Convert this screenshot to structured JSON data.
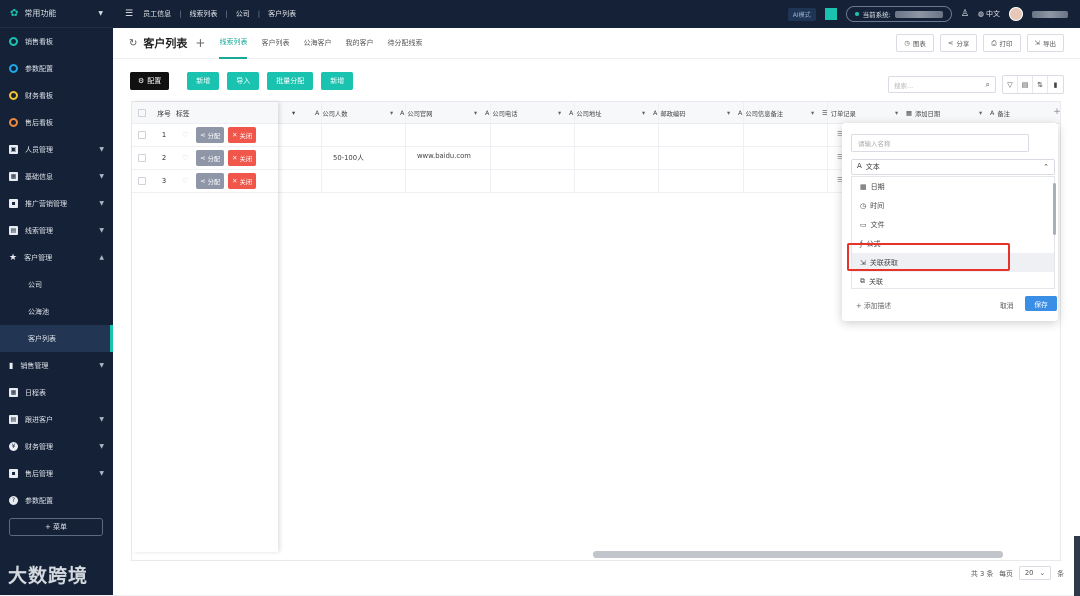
{
  "sidebar": {
    "top_label": "常用功能",
    "items": [
      {
        "label": "销售看板",
        "ring": "#19c3b0"
      },
      {
        "label": "参数配置",
        "ring": "#1ea8e8"
      },
      {
        "label": "财务看板",
        "ring": "#f2c230"
      },
      {
        "label": "售后看板",
        "ring": "#f08a3c"
      },
      {
        "label": "人员管理"
      },
      {
        "label": "基础信息"
      },
      {
        "label": "推广营销管理"
      },
      {
        "label": "线索管理"
      },
      {
        "label": "客户管理"
      },
      {
        "label": "公司"
      },
      {
        "label": "公海池"
      },
      {
        "label": "客户列表"
      },
      {
        "label": "销售管理"
      },
      {
        "label": "日程表"
      },
      {
        "label": "跟进客户"
      },
      {
        "label": "财务管理"
      },
      {
        "label": "售后管理"
      },
      {
        "label": "参数配置"
      }
    ],
    "menu_button": "+ 菜单",
    "watermark": "大数跨境"
  },
  "topbar": {
    "breadcrumb": [
      "员工信息",
      "线索列表",
      "公司",
      "客户列表"
    ],
    "ai_label": "AI模式",
    "system_label": "当前系统:",
    "lang": "中文"
  },
  "page": {
    "title": "客户列表",
    "tabs": [
      "线索列表",
      "客户列表",
      "公海客户",
      "我的客户",
      "待分配线索"
    ],
    "head_buttons": [
      "图表",
      "分享",
      "打印",
      "导出"
    ]
  },
  "toolbar": {
    "config": "配置",
    "buttons": [
      "新增",
      "导入",
      "批量分配",
      "新增"
    ],
    "search_placeholder": "搜索..."
  },
  "table": {
    "headers": [
      "序号",
      "标签",
      "公司人数",
      "公司官网",
      "公司电话",
      "公司地址",
      "邮政编码",
      "公司信息备注",
      "订单记录",
      "添加日期",
      "备注"
    ],
    "rows": [
      {
        "seq": "1",
        "employees": "",
        "website": ""
      },
      {
        "seq": "2",
        "employees": "50-100人",
        "website": "www.baidu.com"
      },
      {
        "seq": "3",
        "employees": "",
        "website": ""
      }
    ],
    "assign_label": "分配",
    "close_label": "关闭"
  },
  "footer": {
    "total": "共 3 条",
    "per_page_label": "每页",
    "per_page": "20",
    "unit": "条"
  },
  "popup": {
    "name_placeholder": "请输入名称",
    "selected_type": "文本",
    "options": [
      "日期",
      "时间",
      "文件",
      "公式",
      "关联获取",
      "关联"
    ],
    "add_desc": "+ 添加描述",
    "cancel": "取消",
    "save": "保存"
  }
}
